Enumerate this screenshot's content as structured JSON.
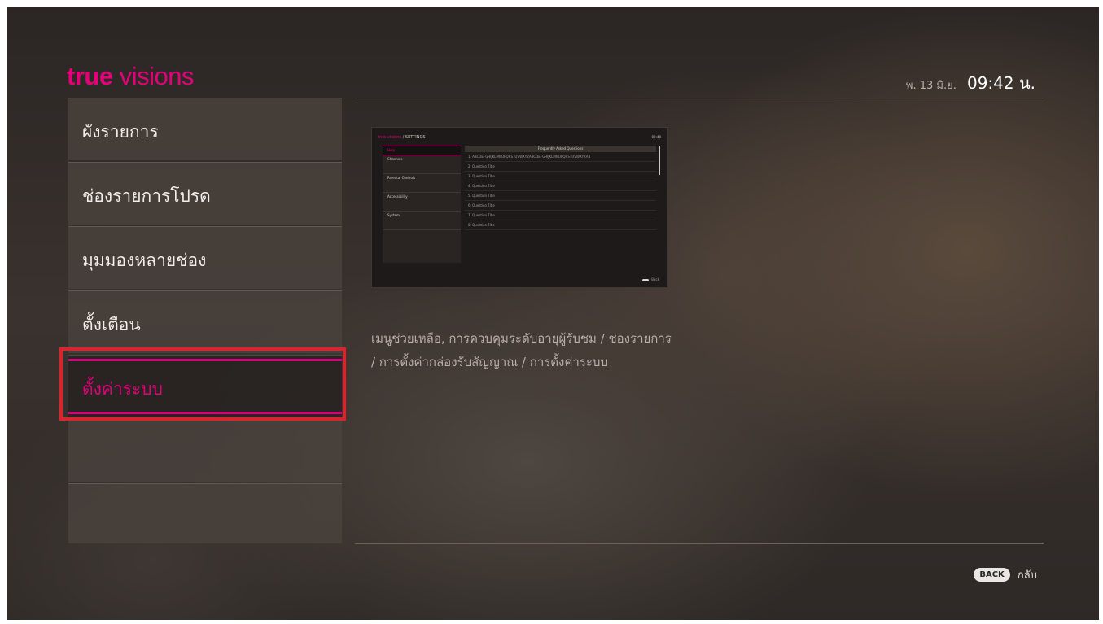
{
  "header": {
    "logo_part1": "true",
    "logo_part2": "visions",
    "date": "พ. 13 มิ.ย.",
    "time": "09:42 น."
  },
  "menu": {
    "items": [
      {
        "label": "ผังรายการ"
      },
      {
        "label": "ช่องรายการโปรด"
      },
      {
        "label": "มุมมองหลายช่อง"
      },
      {
        "label": "ตั้งเตือน"
      },
      {
        "label": "ตั้งค่าระบบ"
      }
    ],
    "selected_index": 4
  },
  "preview": {
    "logo": "true visions",
    "section": "SETTINGS",
    "clock": "09:40",
    "sidebar": [
      "Help",
      "Channels",
      "Parental Controls",
      "Accessibility",
      "System"
    ],
    "main_title": "Frequently Asked Questions",
    "questions": [
      "1. ABCDEFGHIJKLMNOPQRSTUVWXYZABCDEFGHIJKLMNOPQRSTUVWXYZAB",
      "2. Question Title",
      "3. Question Title",
      "4. Question Title",
      "5. Question Title",
      "6. Question Title",
      "7. Question Title",
      "8. Question Title"
    ],
    "back_label": "Back"
  },
  "description": {
    "line1": "เมนูช่วยเหลือ, การควบคุมระดับอายุผู้รับชม / ช่องรายการ",
    "line2": "/ การตั้งค่ากล่องรับสัญญาณ / การตั้งค่าระบบ"
  },
  "footer": {
    "back_button": "BACK",
    "back_text": "กลับ"
  },
  "colors": {
    "accent": "#e4007a",
    "highlight_outline": "#e61e2a"
  }
}
